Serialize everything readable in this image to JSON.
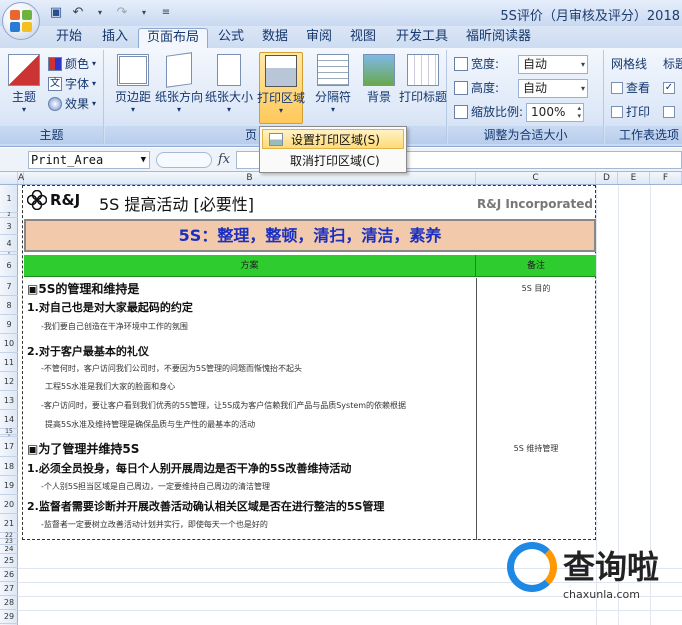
{
  "window": {
    "title": "5S评价（月审核及评分）2018"
  },
  "tabs": [
    {
      "label": "开始"
    },
    {
      "label": "插入"
    },
    {
      "label": "页面布局"
    },
    {
      "label": "公式"
    },
    {
      "label": "数据"
    },
    {
      "label": "审阅"
    },
    {
      "label": "视图"
    },
    {
      "label": "开发工具"
    },
    {
      "label": "福昕阅读器"
    }
  ],
  "ribbon": {
    "theme": {
      "themes": "主题",
      "colors": "颜色",
      "fonts": "字体",
      "effects": "效果",
      "group": "主题"
    },
    "page_setup": {
      "margins": "页边距",
      "orientation": "纸张方向",
      "size": "纸张大小",
      "print_area": "打印区域",
      "breaks": "分隔符",
      "background": "背景",
      "print_titles": "打印标题",
      "group": "页"
    },
    "scale": {
      "width_label": "宽度:",
      "width_value": "自动",
      "height_label": "高度:",
      "height_value": "自动",
      "scale_label": "缩放比例:",
      "scale_value": "100%",
      "group": "调整为合适大小"
    },
    "sheet_options": {
      "gridlines": "网格线",
      "headings": "标题",
      "view": "查看",
      "print": "打印",
      "group": "工作表选项"
    }
  },
  "menu": {
    "set_print_area": "设置打印区域(S)",
    "clear_print_area": "取消打印区域(C)"
  },
  "formula_bar": {
    "name_box": "Print_Area",
    "fx": "fx"
  },
  "columns": [
    "A",
    "B",
    "C",
    "D",
    "E",
    "F"
  ],
  "rows": [
    "1",
    "2",
    "3",
    "4",
    "5",
    "6",
    "7",
    "8",
    "9",
    "10",
    "11",
    "12",
    "13",
    "14",
    "15",
    "16",
    "17",
    "18",
    "19",
    "20",
    "21",
    "22",
    "23",
    "24",
    "25",
    "26",
    "27",
    "28",
    "29",
    "30"
  ],
  "doc": {
    "logo": "R&J",
    "title": "5S 提高活动 [必要性]",
    "company": "R&J Incorporated",
    "banner": "5S：整理，整顿，清扫，清洁，素养",
    "col_scheme": "方案",
    "col_note": "备注",
    "lines": [
      {
        "text": "▣5S的管理和维持是"
      },
      {
        "text": "1.对自己也是对大家最起码的约定"
      },
      {
        "text": "-我们要自己创造在干净环境中工作的氛围"
      },
      {
        "text": "2.对于客户最基本的礼仪"
      },
      {
        "text": "-不管何时，客户访问我们公司时，不要因为5S管理的问题而惭愧抬不起头"
      },
      {
        "text": "工程5S水准是我们大家的脸面和身心"
      },
      {
        "text": "-客户访问时，要让客户看到我们优秀的5S管理，让5S成为客户信赖我们产品与品质System的依赖根据"
      },
      {
        "text": "提高5S水准及维持管理是确保品质与生产性的最基本的活动"
      },
      {
        "text": "▣为了管理并维持5S"
      },
      {
        "text": "1.必须全员投身，每日个人别开展周边是否干净的5S改善维持活动"
      },
      {
        "text": "-个人别5S担当区域是自己周边，一定要维持自己周边的清洁管理"
      },
      {
        "text": "2.监督者需要诊断并开展改善活动确认相关区域是否在进行整洁的5S管理"
      },
      {
        "text": "-监督者一定要树立改善活动计划并实行，即使每天一个也是好的"
      }
    ],
    "notes": {
      "n1": "5S 目的",
      "n2": "5S 维持管理"
    }
  },
  "watermark": {
    "text": "查询啦",
    "url": "chaxunla.com"
  },
  "colors": {
    "ribbon": "#dce7f7",
    "banner": "#f3c9ab",
    "header": "#2ecc2e",
    "banner_text": "#1a2fbf"
  }
}
